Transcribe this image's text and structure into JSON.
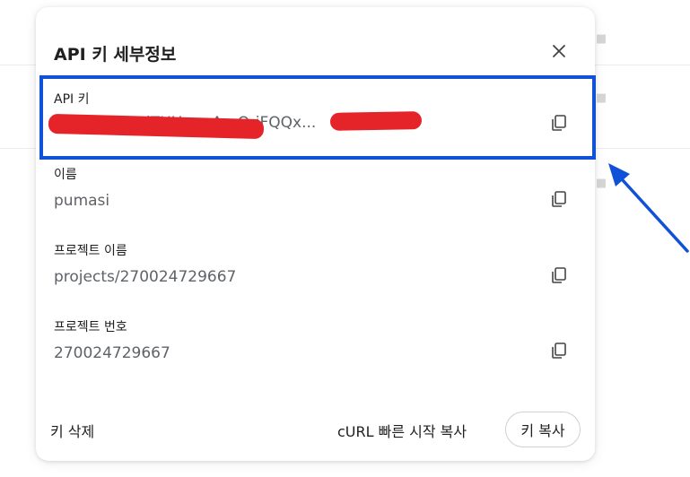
{
  "dialog": {
    "title": "API 키 세부정보",
    "close_icon": "close-icon"
  },
  "fields": [
    {
      "label": "API 키",
      "value": "...Q...HETF...lTHU...mAxrO-iFQQx...",
      "copy_icon": "copy-icon",
      "redacted": true
    },
    {
      "label": "이름",
      "value": "pumasi",
      "copy_icon": "copy-icon"
    },
    {
      "label": "프로젝트 이름",
      "value": "projects/270024729667",
      "copy_icon": "copy-icon"
    },
    {
      "label": "프로젝트 번호",
      "value": "270024729667",
      "copy_icon": "copy-icon"
    }
  ],
  "footer": {
    "delete_label": "키 삭제",
    "curl_label": "cURL 빠른 시작 복사",
    "copy_key_label": "키 복사"
  },
  "annotation": {
    "highlight_color": "#1151d8",
    "redaction_color": "#e5242a"
  }
}
